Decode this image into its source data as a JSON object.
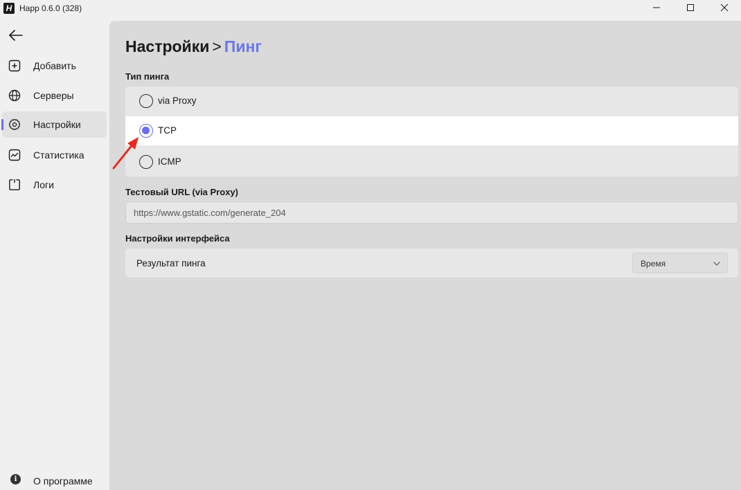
{
  "window": {
    "logo_letter": "H",
    "title": "Happ 0.6.0 (328)"
  },
  "sidebar": {
    "items": [
      {
        "label": "Добавить",
        "icon": "plus-square-icon"
      },
      {
        "label": "Серверы",
        "icon": "globe-icon"
      },
      {
        "label": "Настройки",
        "icon": "gear-icon",
        "active": true
      },
      {
        "label": "Статистика",
        "icon": "chart-icon"
      },
      {
        "label": "Логи",
        "icon": "logs-icon"
      }
    ],
    "about": {
      "label": "О программе",
      "icon_glyph": "i"
    }
  },
  "main": {
    "breadcrumb": {
      "parent": "Настройки",
      "separator": ">",
      "current": "Пинг"
    },
    "ping_type": {
      "section_label": "Тип пинга",
      "options": [
        {
          "label": "via Proxy",
          "selected": false
        },
        {
          "label": "TCP",
          "selected": true
        },
        {
          "label": "ICMP",
          "selected": false
        }
      ]
    },
    "test_url": {
      "section_label": "Тестовый URL (via Proxy)",
      "value": "https://www.gstatic.com/generate_204"
    },
    "interface": {
      "section_label": "Настройки интерфейса",
      "row_label": "Результат пинга",
      "select_value": "Время"
    }
  },
  "colors": {
    "accent": "#6b6ef0",
    "breadcrumb_current": "#6b78e8",
    "annotation_arrow": "#e8281e"
  }
}
